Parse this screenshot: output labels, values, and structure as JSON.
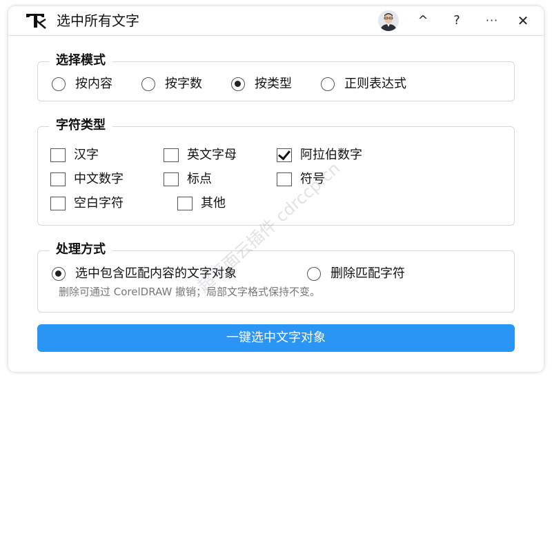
{
  "app": {
    "title": "选中所有文字",
    "controls": {
      "collapse": "^",
      "help": "?",
      "more": "···",
      "close": "✕"
    }
  },
  "select_mode": {
    "legend": "选择模式",
    "options": [
      "按内容",
      "按字数",
      "按类型",
      "正则表达式"
    ],
    "selected": "按类型"
  },
  "char_type": {
    "legend": "字符类型",
    "items": [
      {
        "label": "汉字",
        "checked": false
      },
      {
        "label": "英文字母",
        "checked": false
      },
      {
        "label": "阿拉伯数字",
        "checked": true
      },
      {
        "label": "中文数字",
        "checked": false
      },
      {
        "label": "标点",
        "checked": false
      },
      {
        "label": "符号",
        "checked": false
      },
      {
        "label": "空白字符",
        "checked": false
      },
      {
        "label": "其他",
        "checked": false
      }
    ]
  },
  "process": {
    "legend": "处理方式",
    "options": [
      "选中包含匹配内容的文字对象",
      "删除匹配字符"
    ],
    "selected": "选中包含匹配内容的文字对象",
    "note": "删除可通过 CorelDRAW 撤销；局部文字格式保持不变。"
  },
  "action": {
    "label": "一键选中文字对象",
    "color": "#2b95f5"
  },
  "watermark": "超平面云插件 cdrccp.cn"
}
